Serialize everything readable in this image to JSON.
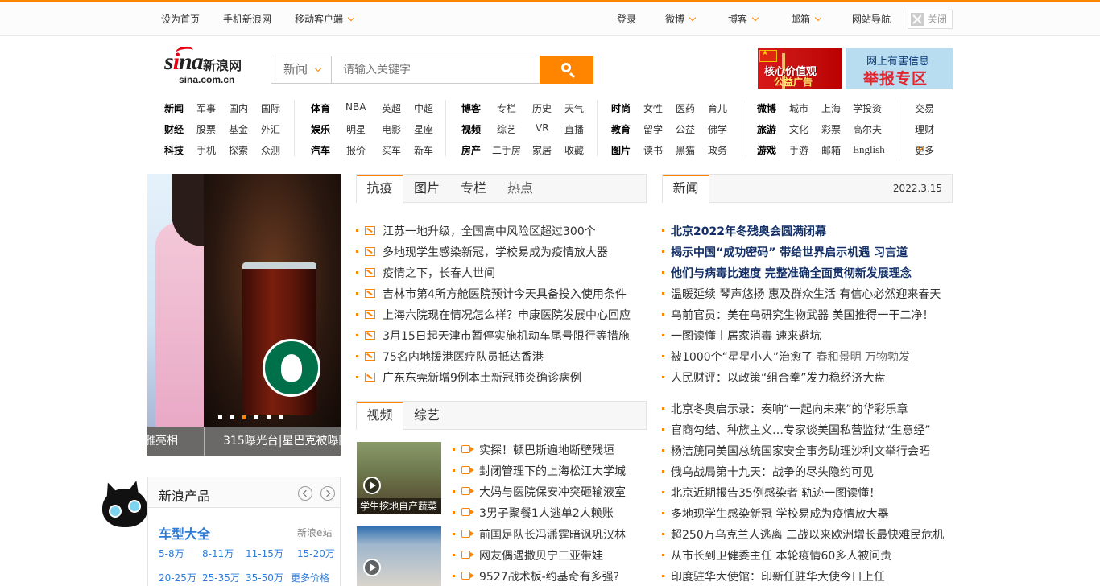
{
  "topbar": {
    "set_home": "设为首页",
    "mobile_sina": "手机新浪网",
    "mobile_client": "移动客户端",
    "login": "登录",
    "weibo": "微博",
    "blog": "博客",
    "mail": "邮箱",
    "site_nav": "网站导航",
    "close": "关闭"
  },
  "logo": {
    "sina": "sina",
    "cn": "新浪网",
    "domain": "sina.com.cn"
  },
  "search": {
    "category": "新闻",
    "placeholder": "请输入关键字"
  },
  "banners": {
    "values_ad_line1": "核心价值观",
    "values_ad_line2": "公益广告",
    "report_line1": "网上有害信息",
    "report_line2": "举报专区"
  },
  "nav": {
    "col1": [
      [
        "新闻",
        "军事",
        "国内",
        "国际"
      ],
      [
        "财经",
        "股票",
        "基金",
        "外汇"
      ],
      [
        "科技",
        "手机",
        "探索",
        "众测"
      ]
    ],
    "col2": [
      [
        "体育",
        "NBA",
        "英超",
        "中超"
      ],
      [
        "娱乐",
        "明星",
        "电影",
        "星座"
      ],
      [
        "汽车",
        "报价",
        "买车",
        "新车"
      ]
    ],
    "col3": [
      [
        "博客",
        "专栏",
        "历史",
        "天气"
      ],
      [
        "视频",
        "综艺",
        "VR",
        "直播"
      ],
      [
        "房产",
        "二手房",
        "家居",
        "收藏"
      ]
    ],
    "col4": [
      [
        "时尚",
        "女性",
        "医药",
        "育儿"
      ],
      [
        "教育",
        "留学",
        "公益",
        "佛学"
      ],
      [
        "图片",
        "读书",
        "黑猫",
        "政务"
      ]
    ],
    "col5": [
      [
        "微博",
        "城市",
        "上海",
        "学投资"
      ],
      [
        "旅游",
        "文化",
        "彩票",
        "高尔夫"
      ],
      [
        "游戏",
        "手游",
        "邮箱",
        "English"
      ]
    ],
    "col6": [
      "交易",
      "理财",
      "更多"
    ]
  },
  "slider": {
    "caption_left": "雅亮相",
    "caption_right": "315曝光台|星巴克被曝隔"
  },
  "products": {
    "title": "新浪产品",
    "car_title": "车型大全",
    "site": "新浪e站",
    "prices": [
      "5-8万",
      "8-11万",
      "11-15万",
      "15-20万",
      "20-25万",
      "25-35万",
      "35-50万",
      "更多价格"
    ]
  },
  "epidemic": {
    "tabs": [
      "抗疫",
      "图片",
      "专栏",
      "热点"
    ],
    "items": [
      "江苏一地升级，全国高中风险区超过300个",
      "多地现学生感染新冠，学校易成为疫情放大器",
      "疫情之下，长春人世间",
      "吉林市第4所方舱医院预计今天具备投入使用条件",
      "上海六院现在情况怎么样？申康医院发展中心回应",
      "3月15日起天津市暂停实施机动车尾号限行等措施",
      "75名内地援港医疗队员抵达香港",
      "广东东莞新增9例本土新冠肺炎确诊病例"
    ]
  },
  "video": {
    "tabs": [
      "视频",
      "综艺"
    ],
    "thumb1_caption": "学生挖地自产蔬菜",
    "items": [
      "实探！顿巴斯遍地断壁残垣",
      "封闭管理下的上海松江大学城",
      "大妈与医院保安冲突砸输液室",
      "3男子聚餐1人逃单2人赖账",
      "前国足队长冯潇霆暗讽巩汉林",
      "网友偶遇撒贝宁三亚带娃",
      "9527战术板-约基奇有多强?"
    ]
  },
  "news": {
    "tab": "新闻",
    "date": "2022.3.15",
    "items": [
      {
        "text": "北京2022年冬残奥会圆满闭幕",
        "bold": true
      },
      {
        "text": "揭示中国“成功密码” 带给世界启示机遇 习言道",
        "bold": true
      },
      {
        "text": "他们与病毒比速度 完整准确全面贯彻新发展理念",
        "bold": true
      },
      {
        "text": "温暖延续 琴声悠扬 惠及群众生活 有信心必然迎来春天",
        "bold": false
      },
      {
        "text": "乌前官员：美在乌研究生物武器 美国推得一干二净！",
        "bold": false
      },
      {
        "text": "一图读懂丨居家消毒 速来避坑",
        "bold": false
      },
      {
        "text": "被1000个“星星小人”治愈了",
        "extra": "春和景明 万物勃发",
        "bold": false
      },
      {
        "text": "人民财评：以政策“组合拳”发力稳经济大盘",
        "bold": false
      }
    ],
    "items2": [
      "北京冬奥启示录：奏响“一起向未来”的华彩乐章",
      "官商勾结、种族主义…专家谈美国私营监狱“生意经”",
      "杨洁篪同美国总统国家安全事务助理沙利文举行会晤",
      "俄乌战局第十九天：战争的尽头隐约可见",
      "北京近期报告35例感染者 轨迹一图读懂！",
      "多地现学生感染新冠 学校易成为疫情放大器",
      "超250万乌克兰人逃离 二战以来欧洲增长最快难民危机",
      "从市长到卫健委主任 本轮疫情60多人被问责",
      "印度驻华大使馆：印新任驻华大使今日上任"
    ]
  },
  "colors": {
    "accent": "#ff8400",
    "headline": "#122e67",
    "link_blue": "#2e7bd7"
  }
}
